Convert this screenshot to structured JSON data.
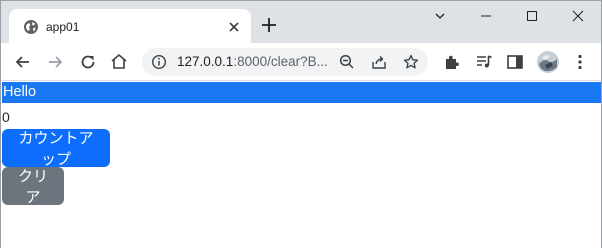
{
  "browser": {
    "tab": {
      "title": "app01"
    },
    "address": {
      "host": "127.0.0.1",
      "rest": ":8000/clear?B..."
    }
  },
  "page": {
    "banner": "Hello",
    "count": "0",
    "buttons": {
      "count_up": "カウントアップ",
      "clear": "クリア"
    }
  },
  "colors": {
    "banner": "#1877f2",
    "primary_button": "#0d6efd",
    "secondary_button": "#6c757d",
    "tabstrip": "#dee1e6"
  }
}
